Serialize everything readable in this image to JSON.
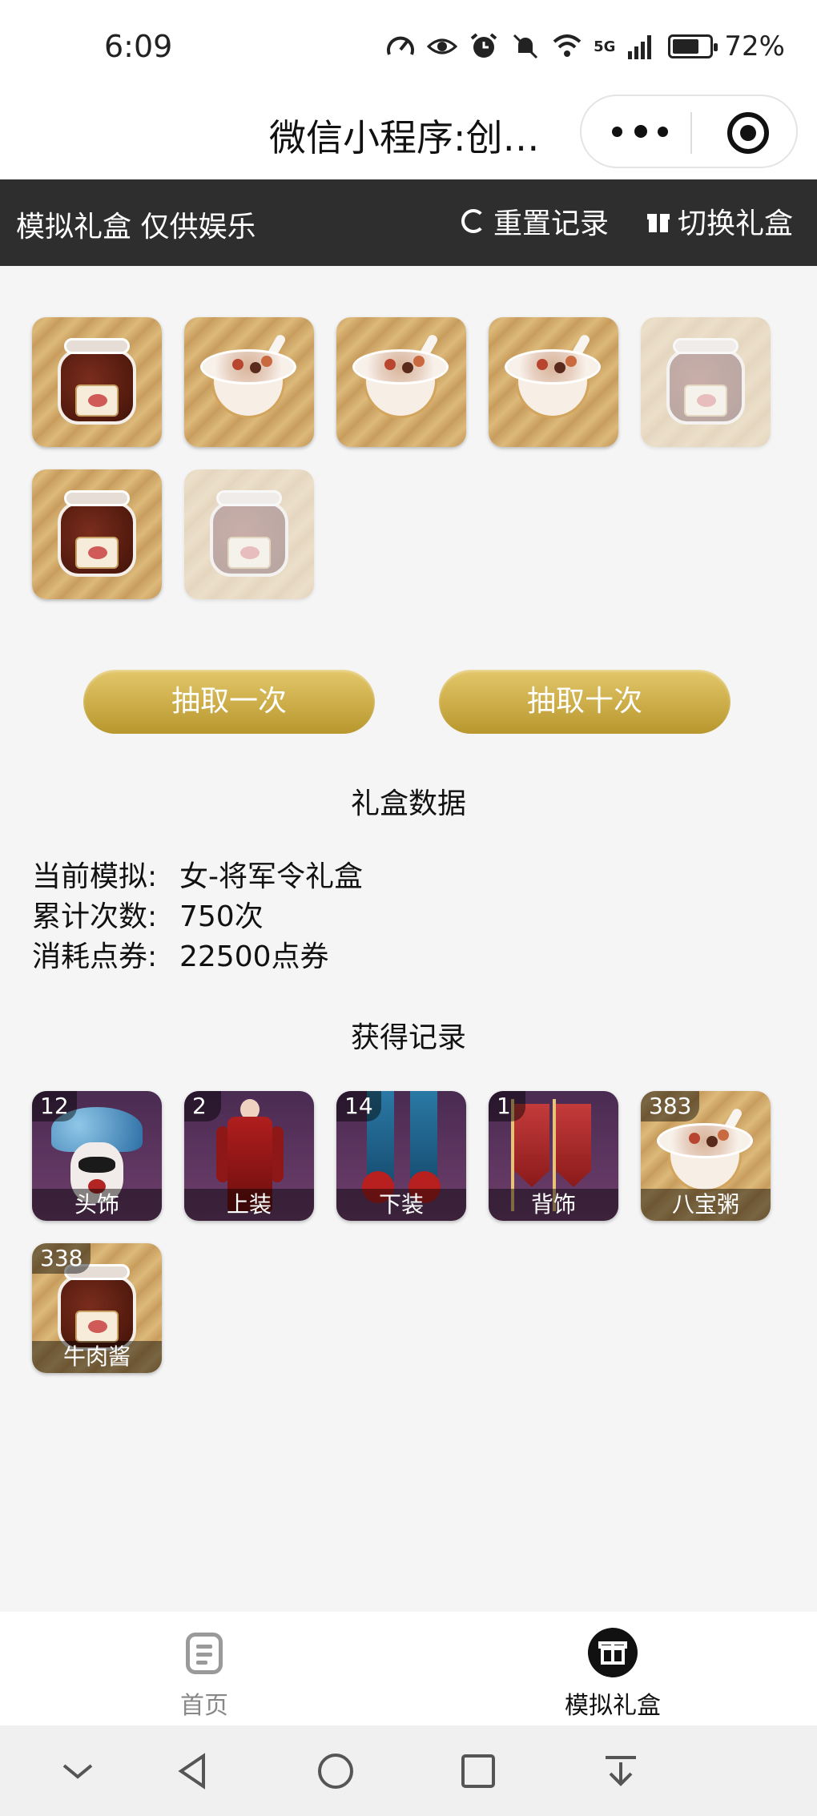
{
  "status_bar": {
    "time": "6:09",
    "network": "5G",
    "battery": "72%",
    "battery_level": 0.72
  },
  "title_bar": {
    "title": "微信小程序:创…"
  },
  "toolbar": {
    "left_text": "模拟礼盒 仅供娱乐",
    "reset_label": "重置记录",
    "switch_label": "切换礼盒"
  },
  "drawn_items": [
    {
      "kind": "jar",
      "faded": false
    },
    {
      "kind": "bowl",
      "faded": false
    },
    {
      "kind": "bowl",
      "faded": false
    },
    {
      "kind": "bowl",
      "faded": false
    },
    {
      "kind": "jar",
      "faded": true
    },
    {
      "kind": "jar",
      "faded": false
    },
    {
      "kind": "jar",
      "faded": true
    }
  ],
  "actions": {
    "draw_once": "抽取一次",
    "draw_ten": "抽取十次"
  },
  "stats": {
    "title": "礼盒数据",
    "rows": [
      {
        "key": "当前模拟:",
        "value": "女-将军令礼盒"
      },
      {
        "key": "累计次数:",
        "value": "750次"
      },
      {
        "key": "消耗点券:",
        "value": "22500点券"
      }
    ]
  },
  "records": {
    "title": "获得记录",
    "items": [
      {
        "count": "12",
        "label": "头饰"
      },
      {
        "count": "2",
        "label": "上装"
      },
      {
        "count": "14",
        "label": "下装"
      },
      {
        "count": "1",
        "label": "背饰"
      },
      {
        "count": "383",
        "label": "八宝粥"
      },
      {
        "count": "338",
        "label": "牛肉酱"
      }
    ]
  },
  "tabs": {
    "home": "首页",
    "gift": "模拟礼盒",
    "active": "gift"
  },
  "icons": {
    "status": [
      "speedometer-icon",
      "eye-icon",
      "alarm-icon",
      "mute-icon",
      "wifi-icon",
      "signal-icon",
      "battery-icon"
    ],
    "nav": [
      "chevron-down-icon",
      "back-icon",
      "home-circle-icon",
      "recents-square-icon",
      "download-icon"
    ]
  },
  "colors": {
    "toolbar_bg": "#2e2e2e",
    "gold": "#c9a941",
    "background": "#f5f5f5"
  }
}
